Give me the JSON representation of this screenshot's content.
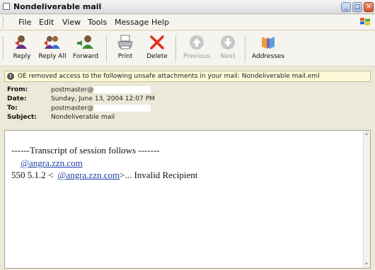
{
  "window": {
    "title": "Nondeliverable mail"
  },
  "menu": [
    "File",
    "Edit",
    "View",
    "Tools",
    "Message",
    "Help"
  ],
  "toolbar": {
    "reply": "Reply",
    "reply_all": "Reply All",
    "forward": "Forward",
    "print": "Print",
    "delete": "Delete",
    "previous": "Previous",
    "next": "Next",
    "addresses": "Addresses"
  },
  "infobar": {
    "text": "OE removed access to the following unsafe attachments in your mail: Nondeliverable mail.eml"
  },
  "header": {
    "from_label": "From:",
    "from_value": "postmaster@",
    "date_label": "Date:",
    "date_value": "Sunday, June 13, 2004 12:07 PM",
    "to_label": "To:",
    "to_value": "postmaster@",
    "subject_label": "Subject:",
    "subject_value": "Nondeliverable mail"
  },
  "body": {
    "transcript_line": "------Transcript of session follows -------",
    "link1": "@angra.zzn.com",
    "code_prefix": "550 5.1.2 <",
    "link2": "@angra.zzn.com",
    "code_suffix": ">... Invalid Recipient"
  },
  "colors": {
    "link": "#1f3fa6",
    "delete_icon": "#e0301c",
    "infobar_bg": "#fdf9d8"
  }
}
